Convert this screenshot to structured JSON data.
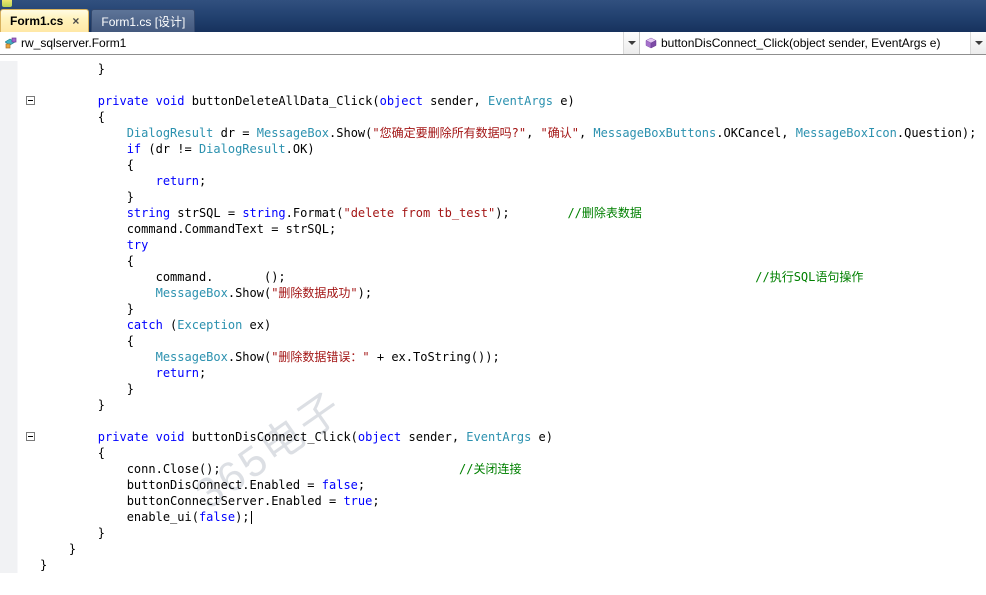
{
  "colors": {
    "keyword": "#0000ff",
    "type": "#2b91af",
    "string": "#a31515",
    "comment": "#008000",
    "plain": "#000000",
    "tab-active-bg": "#ffe8a6"
  },
  "tabs": [
    {
      "label": "Form1.cs",
      "close_glyph": "×",
      "state": "active"
    },
    {
      "label": "Form1.cs [设计]",
      "state": "inactive"
    }
  ],
  "navbar": {
    "type_dropdown": "rw_sqlserver.Form1",
    "member_dropdown": "buttonDisConnect_Click(object sender, EventArgs e)"
  },
  "editor": {
    "watermark": "365电子",
    "folds": [
      2,
      23
    ],
    "fold_ranges": [
      [
        2,
        21
      ],
      [
        23,
        29
      ]
    ],
    "lines": [
      [
        [
          "p",
          "        }"
        ]
      ],
      [
        [
          "p",
          ""
        ]
      ],
      [
        [
          "p",
          "        "
        ],
        [
          "k",
          "private"
        ],
        [
          "p",
          " "
        ],
        [
          "k",
          "void"
        ],
        [
          "p",
          " buttonDeleteAllData_Click("
        ],
        [
          "k",
          "object"
        ],
        [
          "p",
          " sender, "
        ],
        [
          "t",
          "EventArgs"
        ],
        [
          "p",
          " e)"
        ]
      ],
      [
        [
          "p",
          "        {"
        ]
      ],
      [
        [
          "p",
          "            "
        ],
        [
          "t",
          "DialogResult"
        ],
        [
          "p",
          " dr = "
        ],
        [
          "t",
          "MessageBox"
        ],
        [
          "p",
          ".Show("
        ],
        [
          "s",
          "\"您确定要删除所有数据吗?\""
        ],
        [
          "p",
          ", "
        ],
        [
          "s",
          "\"确认\""
        ],
        [
          "p",
          ", "
        ],
        [
          "t",
          "MessageBoxButtons"
        ],
        [
          "p",
          ".OKCancel, "
        ],
        [
          "t",
          "MessageBoxIcon"
        ],
        [
          "p",
          ".Question);"
        ]
      ],
      [
        [
          "p",
          "            "
        ],
        [
          "k",
          "if"
        ],
        [
          "p",
          " (dr != "
        ],
        [
          "t",
          "DialogResult"
        ],
        [
          "p",
          ".OK)"
        ]
      ],
      [
        [
          "p",
          "            {"
        ]
      ],
      [
        [
          "p",
          "                "
        ],
        [
          "k",
          "return"
        ],
        [
          "p",
          ";"
        ]
      ],
      [
        [
          "p",
          "            }"
        ]
      ],
      [
        [
          "p",
          "            "
        ],
        [
          "k",
          "string"
        ],
        [
          "p",
          " strSQL = "
        ],
        [
          "k",
          "string"
        ],
        [
          "p",
          ".Format("
        ],
        [
          "s",
          "\"delete from tb_test\""
        ],
        [
          "p",
          ");        "
        ],
        [
          "c",
          "//删除表数据"
        ]
      ],
      [
        [
          "p",
          "            command.CommandText = strSQL;"
        ]
      ],
      [
        [
          "p",
          "            "
        ],
        [
          "k",
          "try"
        ]
      ],
      [
        [
          "p",
          "            {"
        ]
      ],
      [
        [
          "p",
          "                command.       ();                                                                 "
        ],
        [
          "c",
          "//执行SQL语句操作"
        ]
      ],
      [
        [
          "p",
          "                "
        ],
        [
          "t",
          "MessageBox"
        ],
        [
          "p",
          ".Show("
        ],
        [
          "s",
          "\"删除数据成功\""
        ],
        [
          "p",
          ");"
        ]
      ],
      [
        [
          "p",
          "            }"
        ]
      ],
      [
        [
          "p",
          "            "
        ],
        [
          "k",
          "catch"
        ],
        [
          "p",
          " ("
        ],
        [
          "t",
          "Exception"
        ],
        [
          "p",
          " ex)"
        ]
      ],
      [
        [
          "p",
          "            {"
        ]
      ],
      [
        [
          "p",
          "                "
        ],
        [
          "t",
          "MessageBox"
        ],
        [
          "p",
          ".Show("
        ],
        [
          "s",
          "\"删除数据错误：\""
        ],
        [
          "p",
          " + ex.ToString());"
        ]
      ],
      [
        [
          "p",
          "                "
        ],
        [
          "k",
          "return"
        ],
        [
          "p",
          ";"
        ]
      ],
      [
        [
          "p",
          "            }"
        ]
      ],
      [
        [
          "p",
          "        }"
        ]
      ],
      [
        [
          "p",
          ""
        ]
      ],
      [
        [
          "p",
          "        "
        ],
        [
          "k",
          "private"
        ],
        [
          "p",
          " "
        ],
        [
          "k",
          "void"
        ],
        [
          "p",
          " buttonDisConnect_Click("
        ],
        [
          "k",
          "object"
        ],
        [
          "p",
          " sender, "
        ],
        [
          "t",
          "EventArgs"
        ],
        [
          "p",
          " e)"
        ]
      ],
      [
        [
          "p",
          "        {"
        ]
      ],
      [
        [
          "p",
          "            conn.Close();                                 "
        ],
        [
          "c",
          "//关闭连接"
        ]
      ],
      [
        [
          "p",
          "            buttonDisConnect.Enabled = "
        ],
        [
          "k",
          "false"
        ],
        [
          "p",
          ";"
        ]
      ],
      [
        [
          "p",
          "            buttonConnectServer.Enabled = "
        ],
        [
          "k",
          "true"
        ],
        [
          "p",
          ";"
        ]
      ],
      [
        [
          "p",
          "            enable_ui("
        ],
        [
          "k",
          "false"
        ],
        [
          "p",
          ");"
        ],
        [
          "caret",
          ""
        ]
      ],
      [
        [
          "p",
          "        }"
        ]
      ],
      [
        [
          "p",
          "    }"
        ]
      ],
      [
        [
          "p",
          "}"
        ]
      ]
    ]
  }
}
